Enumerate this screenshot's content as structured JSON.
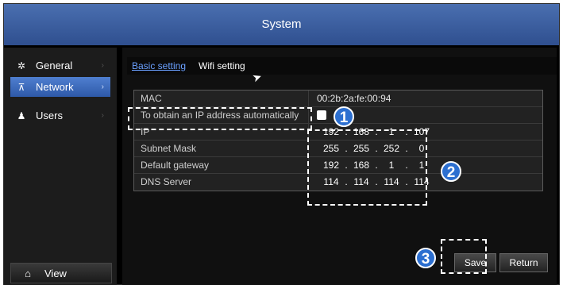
{
  "window": {
    "title": "System"
  },
  "sidebar": {
    "items": [
      {
        "label": "General",
        "icon": "gears-icon"
      },
      {
        "label": "Network",
        "icon": "network-icon",
        "active": true
      },
      {
        "label": "Users",
        "icon": "users-icon"
      }
    ],
    "bottom": {
      "label": "View",
      "icon": "home-icon"
    }
  },
  "tabs": [
    {
      "label": "Basic setting",
      "active": true
    },
    {
      "label": "Wifi setting"
    }
  ],
  "settings": {
    "mac": {
      "label": "MAC",
      "value": "00:2b:2a:fe:00:94"
    },
    "auto_ip": {
      "label": "To obtain an IP address automatically",
      "checked": false
    },
    "ip": {
      "label": "IP",
      "octets": [
        "192",
        "168",
        "1",
        "107"
      ]
    },
    "subnet": {
      "label": "Subnet Mask",
      "octets": [
        "255",
        "255",
        "252",
        "0"
      ]
    },
    "gateway": {
      "label": "Default gateway",
      "octets": [
        "192",
        "168",
        "1",
        "1"
      ]
    },
    "dns": {
      "label": "DNS Server",
      "octets": [
        "114",
        "114",
        "114",
        "114"
      ]
    }
  },
  "buttons": {
    "save": "Save",
    "return": "Return"
  },
  "annotations": {
    "step1": "1",
    "step2": "2",
    "step3": "3"
  },
  "colors": {
    "accent": "#4f7fd0",
    "tab_active": "#6aa0ff",
    "badge": "#2c6fd0"
  }
}
